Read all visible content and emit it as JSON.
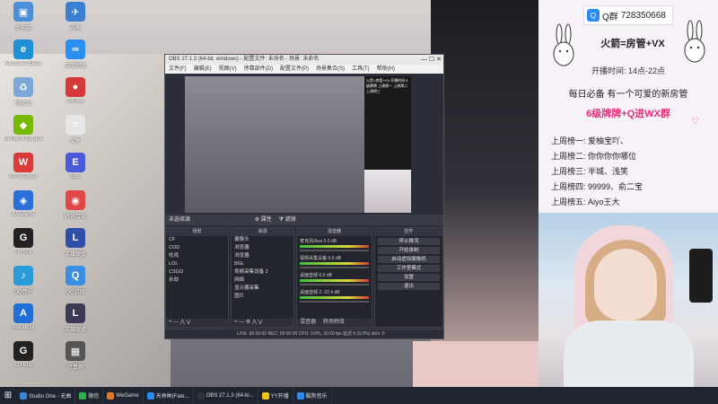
{
  "desktop_icons": [
    {
      "label": "此电脑",
      "color": "#4c8fd6",
      "glyph": "▣"
    },
    {
      "label": "吉冕",
      "color": "#3b7fd1",
      "glyph": "✈"
    },
    {
      "label": "Microsoft Edge",
      "color": "#1f8fd6",
      "glyph": "e"
    },
    {
      "label": "百度网盘",
      "color": "#2b8ef0",
      "glyph": "∞"
    },
    {
      "label": "回收站",
      "color": "#7da7d9",
      "glyph": "♻"
    },
    {
      "label": "AirPlay",
      "color": "#d43a3a",
      "glyph": "●"
    },
    {
      "label": "GeForce Experience",
      "color": "#76b900",
      "glyph": "◆"
    },
    {
      "label": "文件",
      "color": "#e6e6e6",
      "glyph": "≡"
    },
    {
      "label": "WPS Office",
      "color": "#d93a3a",
      "glyph": "W"
    },
    {
      "label": "Epic",
      "color": "#4b5ad8",
      "glyph": "E"
    },
    {
      "label": "WeGame",
      "color": "#2b6fd8",
      "glyph": "◈"
    },
    {
      "label": "腾讯会议",
      "color": "#e04848",
      "glyph": "◉"
    },
    {
      "label": "G HUB",
      "color": "#222222",
      "glyph": "G"
    },
    {
      "label": "英雄联盟",
      "color": "#3050a8",
      "glyph": "L"
    },
    {
      "label": "QQ音乐",
      "color": "#2a9ad8",
      "glyph": "♪"
    },
    {
      "label": "QQ游戏",
      "color": "#3b8ee0",
      "glyph": "Q"
    },
    {
      "label": "Autodesk",
      "color": "#1f6fd6",
      "glyph": "A"
    },
    {
      "label": "英雄联盟",
      "color": "#3a3a55",
      "glyph": "L"
    },
    {
      "label": "G HUB",
      "color": "#222222",
      "glyph": "G"
    },
    {
      "label": "计算器",
      "color": "#555555",
      "glyph": "▦"
    }
  ],
  "obs": {
    "title": "OBS 27.1.3 (64-bit, windows) - 配置文件: 未命名 - 场景: 未命名",
    "menu": [
      "文件(F)",
      "编辑(E)",
      "视图(V)",
      "停靠部件(D)",
      "配置文件(P)",
      "场景集合(S)",
      "工具(T)",
      "帮助(H)"
    ],
    "scene_bar_label": "未选择源",
    "scene_bar_buttons": [
      "属性",
      "滤镜"
    ],
    "docks": {
      "scenes": {
        "header": "场景",
        "items": [
          "CF",
          "COD",
          "吃鸡",
          "LOL",
          "CSGO",
          "永劫"
        ]
      },
      "sources": {
        "header": "来源",
        "items": [
          "摄像头",
          "浏览器",
          "浏览器",
          "BGL",
          "视频采集设备 2",
          "网络",
          "显示器采集",
          "图片"
        ]
      },
      "mixer": {
        "header": "混音器",
        "channels": [
          {
            "name": "麦克风/Aux",
            "db": "0.0 dB"
          },
          {
            "name": "视频采集设备",
            "db": "0.0 dB"
          },
          {
            "name": "桌面音频",
            "db": "0.0 dB"
          },
          {
            "name": "桌面音频 2",
            "db": "-22.4 dB"
          }
        ],
        "tabs": [
          "混音器",
          "转场特效"
        ]
      },
      "controls": {
        "header": "控件",
        "buttons": [
          "停止推流",
          "开始录制",
          "启动虚拟摄像机",
          "工作室模式",
          "设置",
          "退出"
        ]
      }
    },
    "status": "LIVE: 00:00:00    REC: 00:00:00    CPU: 9.8%, 30.00 fps    延迟 0 (0.0%)    kb/s: 0"
  },
  "preview_side_text": "火箭=房管+VX 开播时间 6级牌牌 上周榜一 上周榜二 上周榜三",
  "panel": {
    "qq_prefix": "Q群",
    "qq_number": "728350668",
    "title": "火箭=房管+VX",
    "time": "开播时间: 14点-22点",
    "line1": "每日必备  有一个可爱的新房管",
    "group": "6级牌牌+Q进WX群",
    "boards": [
      "上周榜一: 爱柚宝吖、",
      "上周榜二: 你你你你哪位",
      "上周榜三: 半城、浅笑",
      "上周榜四: 99999、俞二宝",
      "上周榜五: Aiyo王大"
    ]
  },
  "taskbar": {
    "items": [
      {
        "label": "Studio One - 无曲",
        "color": "#3a84d8"
      },
      {
        "label": "微信",
        "color": "#2bb24c"
      },
      {
        "label": "WeGame",
        "color": "#e07a26"
      },
      {
        "label": "天林种(Fate...",
        "color": "#2a8cf0"
      },
      {
        "label": "OBS 27.1.3 (64-bi...",
        "color": "#333333"
      },
      {
        "label": "YY开播",
        "color": "#f2c318"
      },
      {
        "label": "酷狗音乐",
        "color": "#2a8cf0"
      }
    ]
  }
}
